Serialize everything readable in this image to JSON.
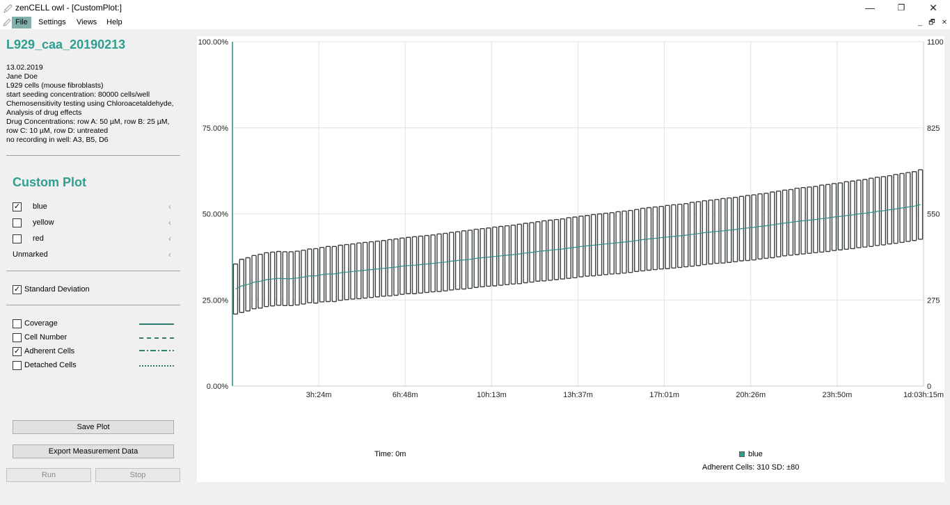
{
  "window": {
    "title": "zenCELL owl - [CustomPlot:]",
    "minimize": "—",
    "maximize": "❐",
    "close": "✕"
  },
  "menu": {
    "items": [
      "File",
      "Settings",
      "Views",
      "Help"
    ],
    "mdi": [
      "_",
      "🗗",
      "✕"
    ]
  },
  "experiment": {
    "name": "L929_caa_20190213",
    "info": [
      "13.02.2019",
      "Jane Doe",
      "L929 cells (mouse fibroblasts)",
      "start seeding concentration: 80000 cells/well",
      "Chemosensitivity testing using Chloroacetaldehyde,",
      "Analysis of drug effects",
      "Drug Concentrations: row A: 50 µM, row B: 25 µM,",
      "row C: 10 µM, row D: untreated",
      "no recording in well: A3, B5, D6"
    ]
  },
  "custom_plot": {
    "title": "Custom Plot",
    "groups": [
      {
        "label": "blue",
        "checked": true
      },
      {
        "label": "yellow",
        "checked": false
      },
      {
        "label": "red",
        "checked": false
      }
    ],
    "unmarked_label": "Unmarked",
    "std_dev": {
      "label": "Standard Deviation",
      "checked": true
    },
    "measures": [
      {
        "label": "Coverage",
        "checked": false,
        "style": "solid"
      },
      {
        "label": "Cell Number",
        "checked": false,
        "style": "dashed"
      },
      {
        "label": "Adherent Cells",
        "checked": true,
        "style": "dashdot"
      },
      {
        "label": "Detached Cells",
        "checked": false,
        "style": "dotted"
      }
    ],
    "check_mark": "✓"
  },
  "buttons": {
    "save": "Save Plot",
    "export": "Export Measurement Data",
    "run": "Run",
    "stop": "Stop"
  },
  "status": {
    "time": "Time: 0m",
    "legend": "blue",
    "readout": "Adherent Cells: 310  SD: ±80"
  },
  "colors": {
    "accent": "#2f9e8f",
    "line": "#2e8f86",
    "bar": "#3a3f3f"
  },
  "chart_data": {
    "type": "line",
    "x_tick_labels": [
      "3h:24m",
      "6h:48m",
      "10h:13m",
      "13h:37m",
      "17h:01m",
      "20h:26m",
      "23h:50m",
      "1d:03h:15m"
    ],
    "y_left_ticks": [
      "0.00%",
      "25.00%",
      "50.00%",
      "75.00%",
      "100.00%"
    ],
    "y_right_ticks": [
      "0",
      "275",
      "550",
      "825",
      "1100"
    ],
    "ylim_right": [
      0,
      1100
    ],
    "grid": true,
    "legend": "bottom",
    "series": [
      {
        "name": "blue",
        "mean": [
          310,
          320,
          325,
          332,
          335,
          340,
          342,
          344,
          343,
          343,
          345,
          348,
          352,
          352,
          356,
          358,
          358,
          362,
          364,
          366,
          368,
          370,
          372,
          374,
          376,
          378,
          380,
          383,
          385,
          386,
          388,
          390,
          392,
          394,
          396,
          399,
          401,
          403,
          405,
          408,
          410,
          412,
          414,
          416,
          418,
          420,
          422,
          425,
          427,
          430,
          432,
          434,
          436,
          438,
          441,
          443,
          446,
          448,
          450,
          452,
          454,
          456,
          458,
          460,
          462,
          465,
          468,
          470,
          472,
          474,
          476,
          478,
          480,
          482,
          485,
          487,
          490,
          492,
          494,
          496,
          498,
          500,
          503,
          505,
          507,
          510,
          512,
          515,
          518,
          521,
          523,
          526,
          528,
          530,
          532,
          535,
          537,
          540,
          542,
          545,
          547,
          550,
          552,
          555,
          558,
          560,
          563,
          566,
          569,
          572,
          575,
          580
        ],
        "sd": [
          80,
          85,
          85,
          85,
          86,
          86,
          86,
          86,
          86,
          86,
          86,
          86,
          86,
          87,
          87,
          88,
          88,
          88,
          88,
          88,
          89,
          89,
          89,
          89,
          89,
          90,
          90,
          90,
          90,
          91,
          91,
          91,
          91,
          92,
          92,
          92,
          92,
          93,
          93,
          93,
          93,
          93,
          94,
          94,
          94,
          94,
          95,
          95,
          95,
          95,
          96,
          96,
          96,
          96,
          97,
          97,
          97,
          97,
          98,
          98,
          98,
          98,
          99,
          99,
          99,
          99,
          100,
          100,
          100,
          100,
          101,
          101,
          101,
          101,
          102,
          102,
          102,
          102,
          102,
          103,
          103,
          103,
          103,
          104,
          104,
          104,
          104,
          105,
          105,
          105,
          105,
          106,
          106,
          106,
          106,
          107,
          107,
          107,
          107,
          108,
          108,
          108,
          108,
          109,
          109,
          109,
          109,
          110,
          110,
          110,
          110,
          111
        ]
      }
    ]
  }
}
